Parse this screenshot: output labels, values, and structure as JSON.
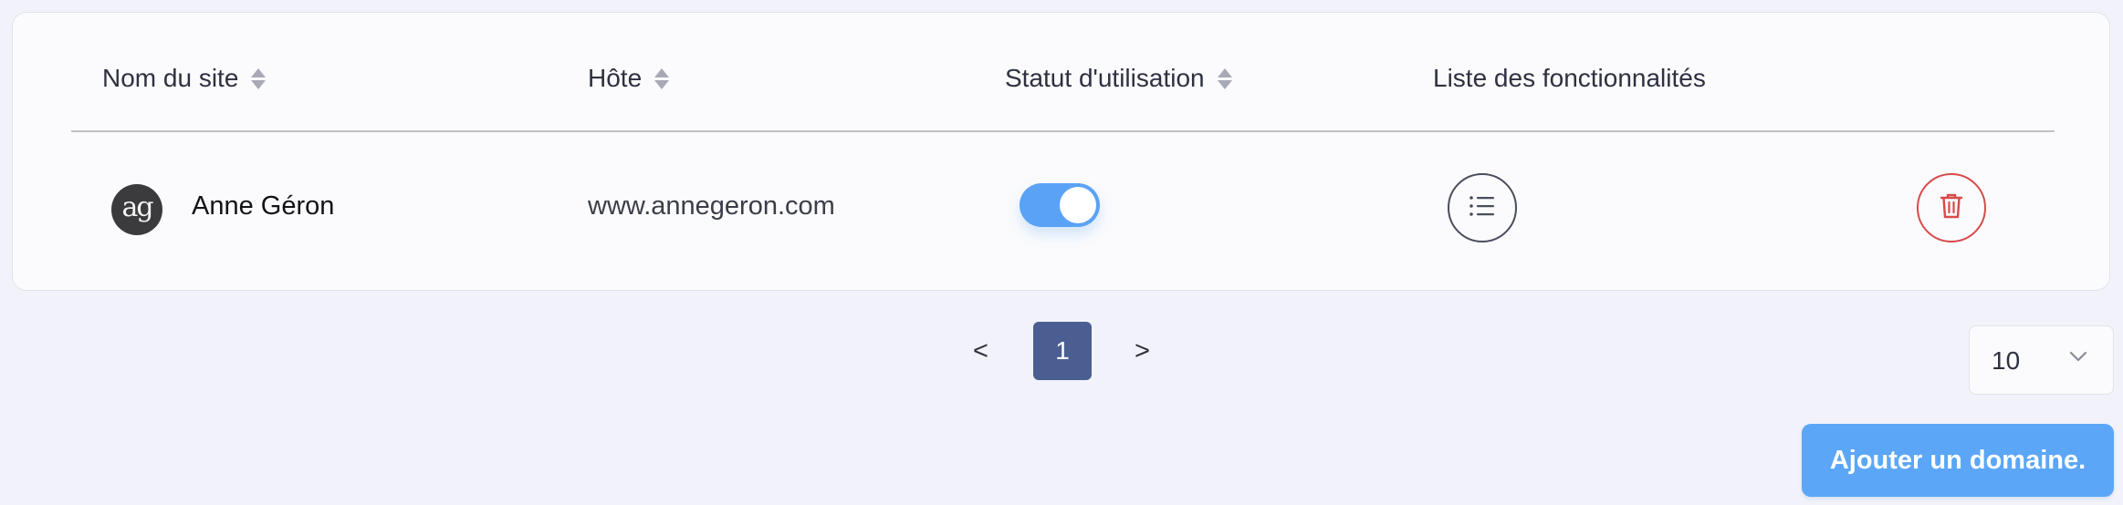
{
  "table": {
    "columns": {
      "site_name": "Nom du site",
      "host": "Hôte",
      "status": "Statut d'utilisation",
      "features": "Liste des fonctionnalités"
    },
    "rows": [
      {
        "avatar_text": "ag",
        "site_name": "Anne Géron",
        "host": "www.annegeron.com",
        "status_enabled": true
      }
    ]
  },
  "pagination": {
    "prev": "<",
    "current_page": "1",
    "next": ">"
  },
  "per_page": {
    "value": "10"
  },
  "add_button": {
    "label": "Ajouter un domaine."
  },
  "colors": {
    "accent": "#5aa2f5",
    "page_active": "#4b5e92",
    "delete": "#d84a4a"
  },
  "icons": {
    "sort": "sort-icon",
    "features": "list-icon",
    "delete": "trash-icon",
    "dropdown": "chevron-down-icon"
  }
}
